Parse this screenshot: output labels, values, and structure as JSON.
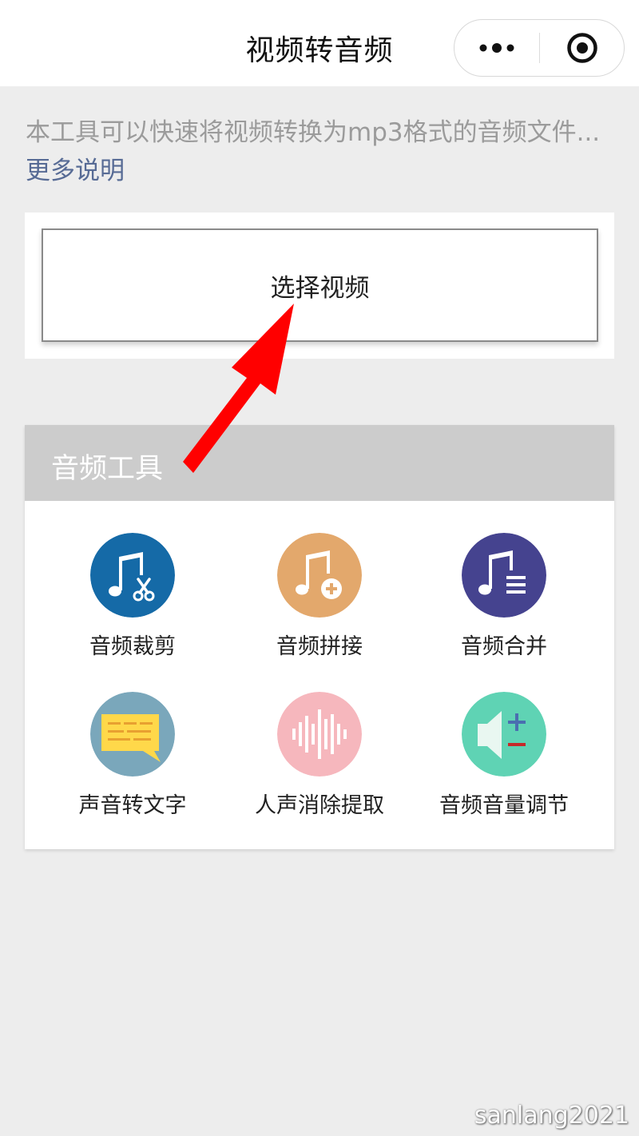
{
  "nav": {
    "title": "视频转音频"
  },
  "description": {
    "text": "本工具可以快速将视频转换为mp3格式的音频文件...",
    "more_link": "更多说明"
  },
  "select_video": {
    "label": "选择视频"
  },
  "tools": {
    "header": "音频工具",
    "items": [
      {
        "label": "音频裁剪",
        "icon": "music-scissors-icon",
        "color": "#156aa7"
      },
      {
        "label": "音频拼接",
        "icon": "music-plus-icon",
        "color": "#e3a86c"
      },
      {
        "label": "音频合并",
        "icon": "music-list-icon",
        "color": "#45438f"
      },
      {
        "label": "声音转文字",
        "icon": "speech-bubble-text-icon",
        "color": "#7aa7bb"
      },
      {
        "label": "人声消除提取",
        "icon": "sound-wave-icon",
        "color": "#f6b7bd"
      },
      {
        "label": "音频音量调节",
        "icon": "volume-adjust-icon",
        "color": "#5fd3b4"
      }
    ]
  },
  "watermark": "sanlang2021"
}
